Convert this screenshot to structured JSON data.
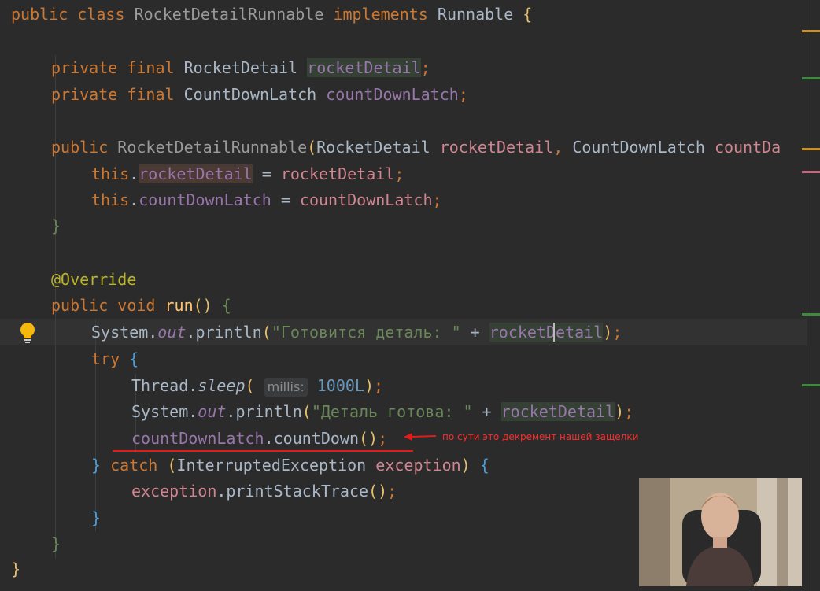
{
  "code": {
    "l1": {
      "public": "public",
      "class": "class",
      "name": "RocketDetailRunnable",
      "implements": "implements",
      "iface": "Runnable",
      "brace": "{"
    },
    "l3": {
      "private": "private",
      "final": "final",
      "type": "RocketDetail",
      "field": "rocketDetail",
      "semi": ";"
    },
    "l4": {
      "private": "private",
      "final": "final",
      "type": "CountDownLatch",
      "field": "countDownLatch",
      "semi": ";"
    },
    "l6": {
      "public": "public",
      "name": "RocketDetailRunnable",
      "open": "(",
      "type1": "RocketDetail",
      "param1": "rocketDetail",
      "comma": ",",
      "type2": "CountDownLatch",
      "param2": "countDa"
    },
    "l7": {
      "this": "this",
      "dot": ".",
      "field": "rocketDetail",
      "eq": " = ",
      "param": "rocketDetail",
      "semi": ";"
    },
    "l8": {
      "this": "this",
      "dot": ".",
      "field": "countDownLatch",
      "eq": " = ",
      "param": "countDownLatch",
      "semi": ";"
    },
    "l9": {
      "brace": "}"
    },
    "l11": {
      "annotation": "@Override"
    },
    "l12": {
      "public": "public",
      "void": "void",
      "method": "run",
      "parens": "()",
      "brace": "{"
    },
    "l13": {
      "cls": "System",
      "dot1": ".",
      "out": "out",
      "dot2": ".",
      "method": "println",
      "open": "(",
      "str": "\"Готовится деталь: \"",
      "plus": " + ",
      "field": "rocketDetail",
      "close": ")",
      "semi": ";"
    },
    "l14": {
      "try": "try",
      "brace": "{"
    },
    "l15": {
      "cls": "Thread",
      "dot": ".",
      "method": "sleep",
      "open": "(",
      "hint": "millis:",
      "num": "1000L",
      "close": ")",
      "semi": ";"
    },
    "l16": {
      "cls": "System",
      "dot1": ".",
      "out": "out",
      "dot2": ".",
      "method": "println",
      "open": "(",
      "str": "\"Деталь готова: \"",
      "plus": " + ",
      "field": "rocketDetail",
      "close": ")",
      "semi": ";"
    },
    "l17": {
      "field": "countDownLatch",
      "dot": ".",
      "method": "countDown",
      "parens": "()",
      "semi": ";"
    },
    "l18": {
      "close": "}",
      "catch": "catch",
      "open": "(",
      "type": "InterruptedException",
      "param": "exception",
      "close2": ")",
      "brace": "{"
    },
    "l19": {
      "param": "exception",
      "dot": ".",
      "method": "printStackTrace",
      "parens": "()",
      "semi": ";"
    },
    "l20": {
      "brace": "}"
    },
    "l21": {
      "brace": "}"
    },
    "l22": {
      "brace": "}"
    }
  },
  "annotation_note": "по сути это декремент нашей защелки",
  "colors": {
    "background": "#2b2b2b",
    "keyword": "#cc7832",
    "field": "#9876aa",
    "string": "#6a8759",
    "number": "#6897bb",
    "method": "#ffc66d",
    "arrow": "#e21b1b"
  },
  "icons": {
    "bulb": "lightbulb-icon",
    "arrow": "red-arrow-icon"
  }
}
